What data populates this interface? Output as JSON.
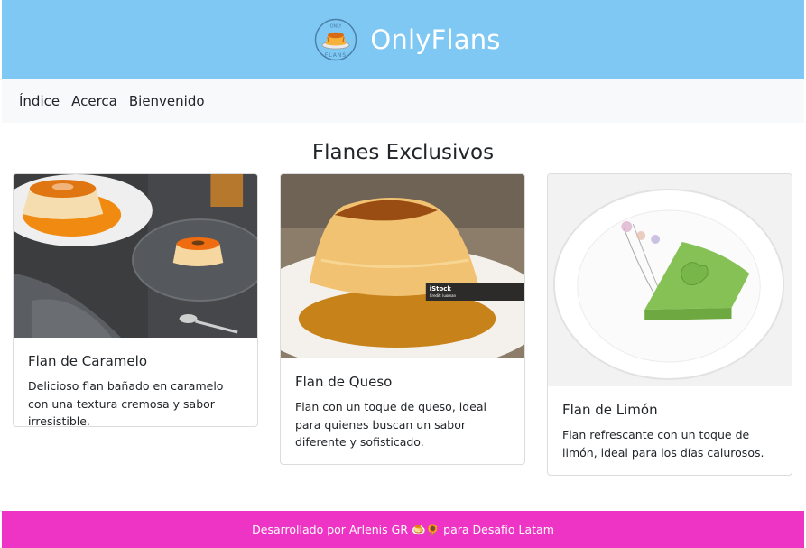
{
  "header": {
    "title": "OnlyFlans",
    "logo_text_top": "ONLY",
    "logo_text_bottom": "FLANS"
  },
  "nav": {
    "items": [
      {
        "label": "Índice"
      },
      {
        "label": "Acerca"
      },
      {
        "label": "Bienvenido"
      }
    ]
  },
  "main": {
    "title": "Flanes Exclusivos",
    "cards": [
      {
        "title": "Flan de Caramelo",
        "text": "Delicioso flan bañado en caramelo con una textura cremosa y sabor irresistible.",
        "image_icon": "caramel-flan-photo"
      },
      {
        "title": "Flan de Queso",
        "text": "Flan con un toque de queso, ideal para quienes buscan un sabor diferente y sofisticado.",
        "image_icon": "cheese-flan-photo",
        "watermark": "iStock",
        "watermark_credit": "Credit: luoman"
      },
      {
        "title": "Flan de Limón",
        "text": "Flan refrescante con un toque de limón, ideal para los días calurosos.",
        "image_icon": "lemon-flan-photo"
      }
    ]
  },
  "footer": {
    "text_before": "Desarrollado por Arlenis GR",
    "emoji": "🍮🌻",
    "text_after": "para Desafío Latam"
  },
  "colors": {
    "header_bg": "#7ec8f3",
    "nav_bg": "#f8f9fa",
    "footer_bg": "#ee34c4"
  }
}
